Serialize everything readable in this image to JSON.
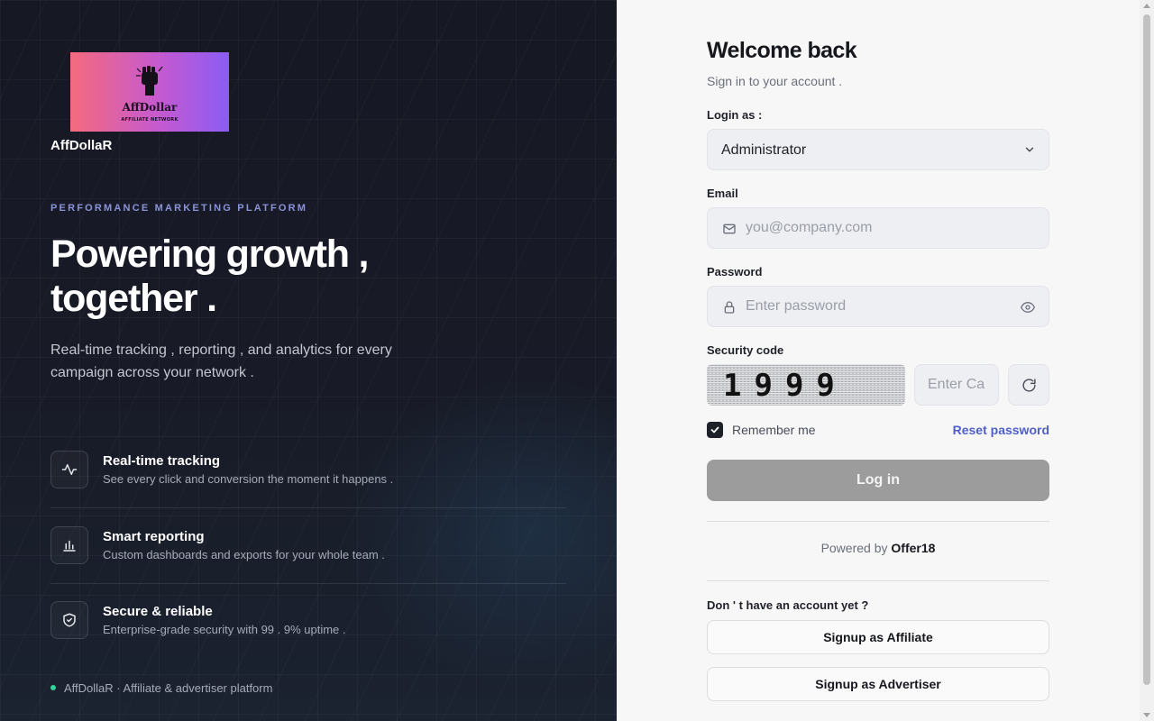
{
  "brand": {
    "logo_name": "AffDollar",
    "logo_tagline": "AFFILIATE NETWORK",
    "name": "AffDollaR"
  },
  "hero": {
    "eyebrow": "PERFORMANCE MARKETING PLATFORM",
    "headline_line1": "Powering growth ,",
    "headline_line2": "together .",
    "subhead": "Real-time tracking , reporting , and analytics for every campaign across your network ."
  },
  "features": [
    {
      "icon": "activity-icon",
      "title": "Real-time tracking",
      "desc": "See every click and conversion the moment it happens ."
    },
    {
      "icon": "bar-chart-icon",
      "title": "Smart reporting",
      "desc": "Custom dashboards and exports for your whole team ."
    },
    {
      "icon": "shield-check-icon",
      "title": "Secure & reliable",
      "desc": "Enterprise-grade security with 99 . 9% uptime ."
    }
  ],
  "footer_note": "AffDollaR · Affiliate & advertiser platform",
  "colors": {
    "status_dot": "#34d399",
    "accent_link": "#4f5fc6",
    "login_button": "#9c9c9c"
  },
  "form": {
    "title": "Welcome back",
    "subtitle": "Sign in to your account .",
    "login_as_label": "Login as :",
    "login_as_value": "Administrator",
    "email_label": "Email",
    "email_placeholder": "you@company.com",
    "email_value": "",
    "password_label": "Password",
    "password_placeholder": "Enter password",
    "password_value": "",
    "security_label": "Security code",
    "captcha_text": "1999",
    "captcha_placeholder": "Enter Captcha",
    "remember_label": "Remember me",
    "remember_checked": true,
    "reset_link": "Reset password",
    "login_button": "Log in",
    "powered_prefix": "Powered by",
    "powered_brand": "Offer18",
    "no_account": "Don ' t have an account yet ?",
    "signup_affiliate": "Signup as Affiliate",
    "signup_advertiser": "Signup as Advertiser"
  }
}
